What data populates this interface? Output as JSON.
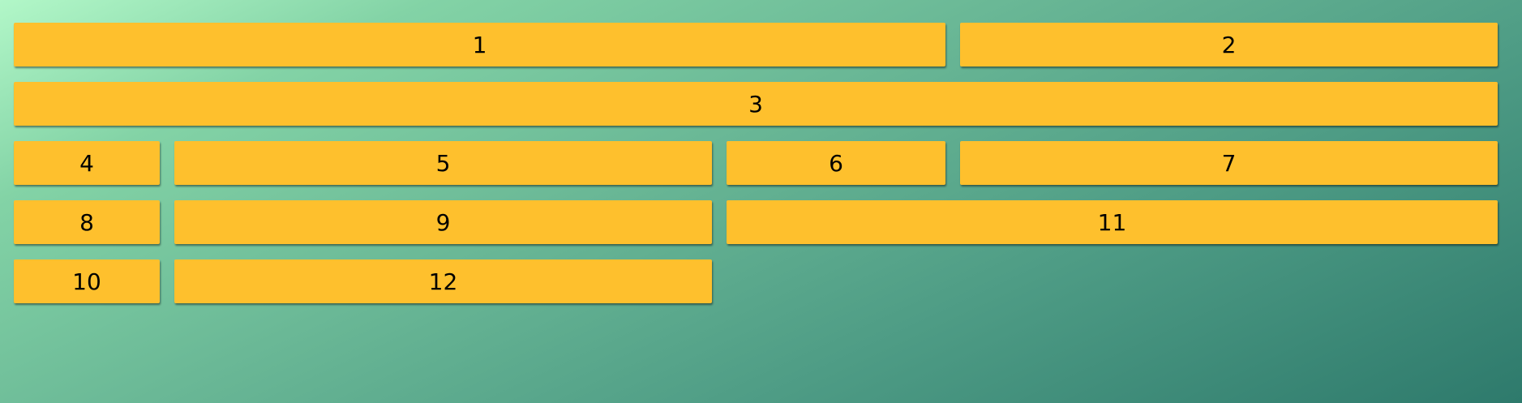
{
  "colors": {
    "tile": "#fec02d",
    "background_start": "#b2f7c8",
    "background_end": "#2e7a6c"
  },
  "tiles": [
    {
      "label": "1"
    },
    {
      "label": "2"
    },
    {
      "label": "3"
    },
    {
      "label": "4"
    },
    {
      "label": "5"
    },
    {
      "label": "6"
    },
    {
      "label": "7"
    },
    {
      "label": "8"
    },
    {
      "label": "9"
    },
    {
      "label": "11"
    },
    {
      "label": "10"
    },
    {
      "label": "12"
    }
  ]
}
